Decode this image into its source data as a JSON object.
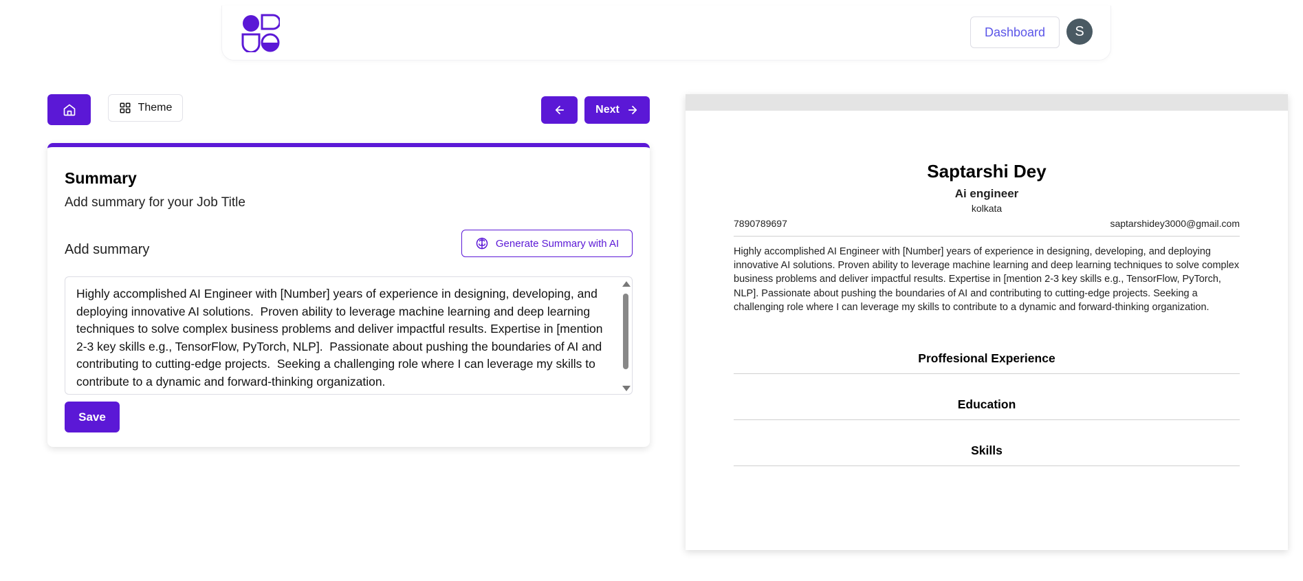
{
  "header": {
    "dashboard_label": "Dashboard",
    "avatar_initial": "S"
  },
  "toolbar": {
    "theme_label": "Theme",
    "next_label": "Next"
  },
  "form": {
    "title": "Summary",
    "subtitle": "Add summary for your Job Title",
    "field_label": "Add summary",
    "generate_label": "Generate Summary with AI",
    "summary_value": "Highly accomplished AI Engineer with [Number] years of experience in designing, developing, and deploying innovative AI solutions.  Proven ability to leverage machine learning and deep learning techniques to solve complex business problems and deliver impactful results. Expertise in [mention 2-3 key skills e.g., TensorFlow, PyTorch, NLP].  Passionate about pushing the boundaries of AI and contributing to cutting-edge projects.  Seeking a challenging role where I can leverage my skills to contribute to a dynamic and forward-thinking organization.",
    "save_label": "Save"
  },
  "resume": {
    "name": "Saptarshi Dey",
    "job_title": "Ai engineer",
    "location": "kolkata",
    "phone": "7890789697",
    "email": "saptarshidey3000@gmail.com",
    "summary": "Highly accomplished AI Engineer with [Number] years of experience in designing, developing, and deploying innovative AI solutions.  Proven ability to leverage machine learning and deep learning techniques to solve complex business problems and deliver impactful results. Expertise in [mention 2-3 key skills e.g., TensorFlow, PyTorch, NLP].  Passionate about pushing the boundaries of AI and contributing to cutting-edge projects.  Seeking a challenging role where I can leverage my skills to contribute to a dynamic and forward-thinking organization.",
    "sections": [
      "Proffesional Experience",
      "Education",
      "Skills"
    ]
  },
  "colors": {
    "accent": "#5b18d6",
    "dashboard_text": "#5b55e8",
    "avatar_bg": "#4a5a63"
  },
  "icons": {
    "home": "home-icon",
    "theme": "grid-icon",
    "prev": "arrow-left-icon",
    "next": "arrow-right-icon",
    "generate": "brain-icon"
  }
}
